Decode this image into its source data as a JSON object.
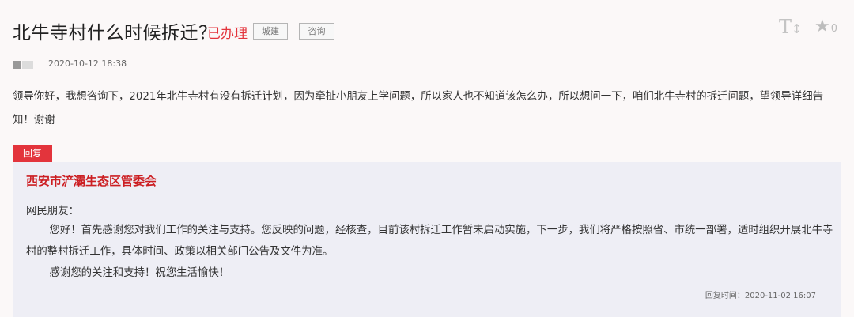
{
  "question": {
    "title": "北牛寺村什么时候拆迁？",
    "status": "已办理",
    "tags": [
      "城建",
      "咨询"
    ],
    "date": "2020-10-12 18:38",
    "content": "领导你好，我想咨询下，2021年北牛寺村有没有拆迁计划，因为牵扯小朋友上学问题，所以家人也不知道该怎么办，所以想问一下，咱们北牛寺村的拆迁问题，望领导详细告知！谢谢"
  },
  "toolbar": {
    "font_icon": "T",
    "font_arrow": "↕",
    "favorite_count": "0"
  },
  "reply": {
    "badge": "回复",
    "org": "西安市浐灞生态区管委会",
    "greeting": "网民朋友：",
    "paragraph1": "您好！首先感谢您对我们工作的关注与支持。您反映的问题，经核查，目前该村拆迁工作暂未启动实施，下一步，我们将严格按照省、市统一部署，适时组织开展北牛寺村的整村拆迁工作，具体时间、政策以相关部门公告及文件为准。",
    "paragraph2": "感谢您的关注和支持！祝您生活愉快！",
    "time_label": "回复时间：",
    "time": "2020-11-02 16:07"
  },
  "colors": {
    "accent": "#e3343c",
    "org": "#cc1e22",
    "reply_bg": "#eeeef5",
    "page_bg": "#fbf8f8"
  }
}
